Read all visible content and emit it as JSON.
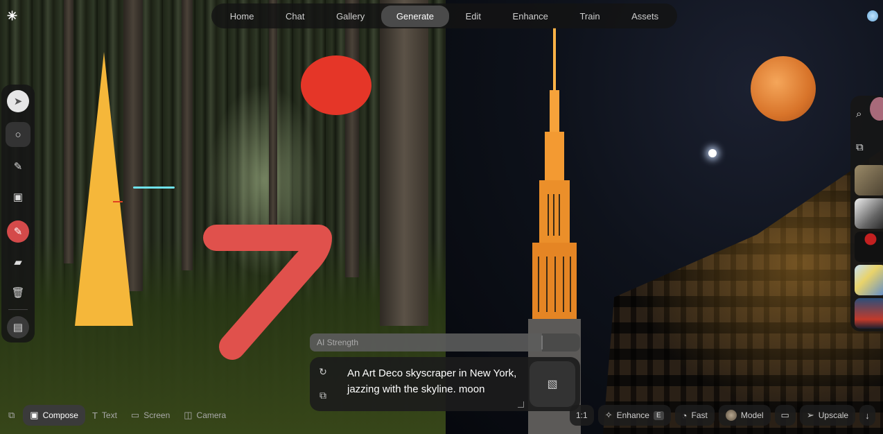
{
  "app": {
    "logo_glyph": "✳"
  },
  "nav": {
    "items": [
      {
        "label": "Home"
      },
      {
        "label": "Chat"
      },
      {
        "label": "Gallery"
      },
      {
        "label": "Generate",
        "active": true
      },
      {
        "label": "Edit"
      },
      {
        "label": "Enhance"
      },
      {
        "label": "Train"
      },
      {
        "label": "Assets"
      }
    ]
  },
  "toolbar": {
    "tools": [
      {
        "name": "select-tool",
        "glyph": "➤"
      },
      {
        "name": "circle-tool",
        "glyph": "○"
      },
      {
        "name": "brush-tool",
        "glyph": "✎"
      },
      {
        "name": "image-tool",
        "glyph": "▣"
      },
      {
        "name": "color-tool",
        "glyph": "✎"
      },
      {
        "name": "eraser-tool",
        "glyph": "▰"
      },
      {
        "name": "delete-tool",
        "glyph": "🗑"
      },
      {
        "name": "canvas-image-tool",
        "glyph": "▤"
      }
    ]
  },
  "ai_strength": {
    "label": "AI Strength",
    "value": 0.86
  },
  "prompt": {
    "text": "An Art Deco skyscraper in New York, jazzing with the skyline. moon",
    "icons": {
      "reset": "↻",
      "shapes": "⧉",
      "image": "▧"
    }
  },
  "bottom_bar": {
    "left": [
      {
        "name": "layers-button",
        "label": "",
        "icon": "⧉"
      },
      {
        "name": "compose-tab",
        "label": "Compose",
        "icon": "▣",
        "active": true
      },
      {
        "name": "text-tab",
        "label": "Text",
        "icon": "T"
      },
      {
        "name": "screen-tab",
        "label": "Screen",
        "icon": "▭"
      },
      {
        "name": "camera-tab",
        "label": "Camera",
        "icon": "◫"
      }
    ],
    "right": {
      "ratio": "1:1",
      "enhance": {
        "label": "Enhance",
        "kbd": "E",
        "icon": "✧"
      },
      "fast": {
        "label": "Fast",
        "icon": "◔"
      },
      "model": {
        "label": "Model"
      },
      "save_icon": "▭",
      "upscale": {
        "label": "Upscale",
        "icon": "➢"
      },
      "download_icon": "↓"
    }
  },
  "right_panel": {
    "search_icon": "⌕",
    "shapes_icon": "⧉"
  },
  "colors": {
    "accent_active": "#4a4a4a",
    "triangle": "#f5b73a",
    "red_circle": "#e53628",
    "stroke_seven": "#e0514c",
    "cyan_line": "#6fe3ef"
  }
}
